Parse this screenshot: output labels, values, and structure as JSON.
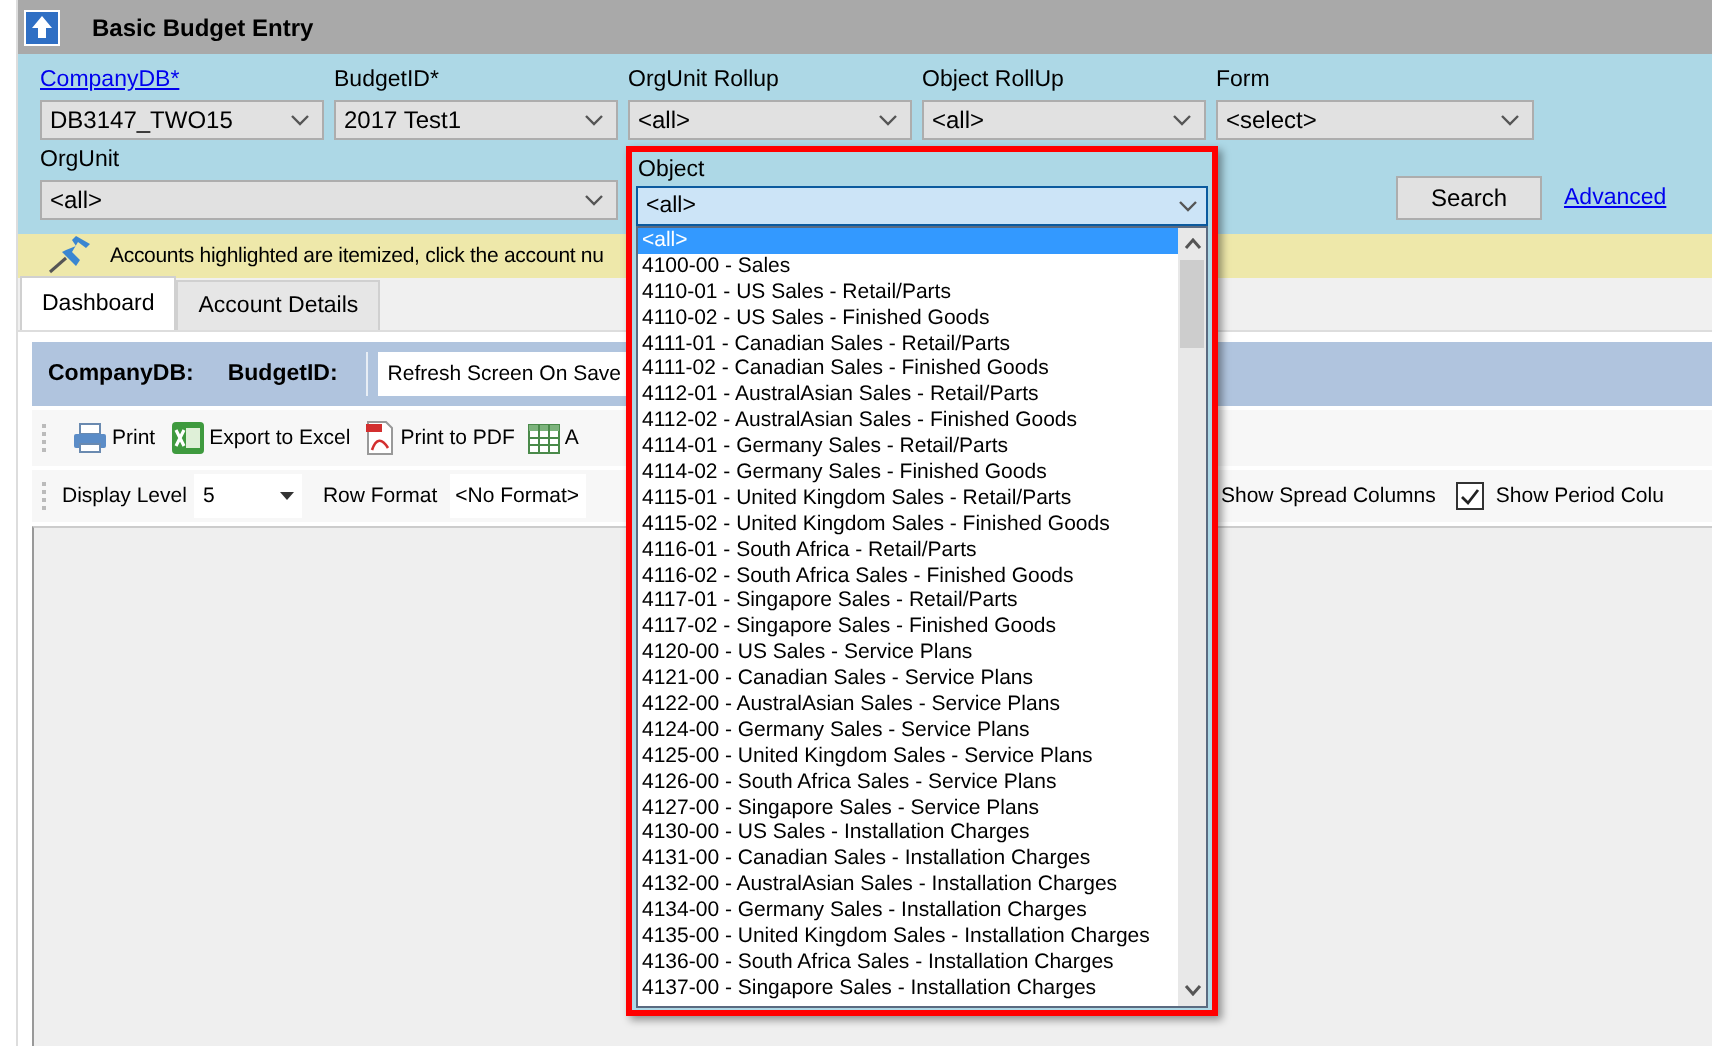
{
  "window": {
    "title": "Basic Budget Entry"
  },
  "filters": [
    {
      "label": "CompanyDB*",
      "kind": "link",
      "value": "DB3147_TWO15"
    },
    {
      "label": "BudgetID*",
      "kind": "plain",
      "value": "2017 Test1"
    },
    {
      "label": "OrgUnit Rollup",
      "kind": "plain",
      "value": "<all>"
    },
    {
      "label": "Object RollUp",
      "kind": "plain",
      "value": "<all>"
    },
    {
      "label": "Form",
      "kind": "plain",
      "value": "<select>"
    },
    {
      "label": "OrgUnit",
      "kind": "plain",
      "value": "<all>"
    }
  ],
  "search_button": "Search",
  "advanced_link": "Advanced",
  "notice": "Accounts highlighted are itemized, click the account nu",
  "tabs": [
    {
      "label": "Dashboard",
      "selected": true
    },
    {
      "label": "Account Details",
      "selected": false
    }
  ],
  "info_bar": {
    "company_label": "CompanyDB:",
    "budget_label": "BudgetID:",
    "refresh_value": "Refresh Screen On Save"
  },
  "toolbar": [
    {
      "label": "Print",
      "kind": "print"
    },
    {
      "label": "Export to Excel",
      "kind": "excel"
    },
    {
      "label": "Print to PDF",
      "kind": "pdf"
    },
    {
      "label": "A",
      "kind": "grid"
    }
  ],
  "options_bar": {
    "display_level_label": "Display Level",
    "display_level": "5",
    "row_format_label": "Row Format",
    "row_format": "<No Format>",
    "checkboxes": [
      {
        "label": "Show Spread Columns"
      },
      {
        "label": "Show Period Colu",
        "checked": true
      }
    ]
  },
  "object_dropdown": {
    "label": "Object",
    "value": "<all>",
    "options": [
      {
        "text": "<all>",
        "selected": true
      },
      {
        "text": "4100-00 - Sales",
        "selected": false
      },
      {
        "text": "4110-01 - US Sales - Retail/Parts",
        "selected": false
      },
      {
        "text": "4110-02 - US Sales - Finished Goods",
        "selected": false
      },
      {
        "text": "4111-01 - Canadian Sales - Retail/Parts",
        "selected": false
      },
      {
        "text": "4111-02 - Canadian Sales - Finished Goods",
        "selected": false
      },
      {
        "text": "4112-01 - AustralAsian Sales - Retail/Parts",
        "selected": false
      },
      {
        "text": "4112-02 - AustralAsian Sales - Finished Goods",
        "selected": false
      },
      {
        "text": "4114-01 - Germany Sales - Retail/Parts",
        "selected": false
      },
      {
        "text": "4114-02 - Germany Sales - Finished Goods",
        "selected": false
      },
      {
        "text": "4115-01 - United Kingdom Sales - Retail/Parts",
        "selected": false
      },
      {
        "text": "4115-02 - United Kingdom Sales - Finished Goods",
        "selected": false
      },
      {
        "text": "4116-01 - South Africa - Retail/Parts",
        "selected": false
      },
      {
        "text": "4116-02 - South Africa Sales - Finished Goods",
        "selected": false
      },
      {
        "text": "4117-01 - Singapore Sales - Retail/Parts",
        "selected": false
      },
      {
        "text": "4117-02 - Singapore Sales - Finished Goods",
        "selected": false
      },
      {
        "text": "4120-00 - US Sales - Service Plans",
        "selected": false
      },
      {
        "text": "4121-00 - Canadian Sales - Service Plans",
        "selected": false
      },
      {
        "text": "4122-00 - AustralAsian Sales - Service Plans",
        "selected": false
      },
      {
        "text": "4124-00 - Germany Sales - Service Plans",
        "selected": false
      },
      {
        "text": "4125-00 - United Kingdom Sales - Service Plans",
        "selected": false
      },
      {
        "text": "4126-00 - South Africa Sales - Service Plans",
        "selected": false
      },
      {
        "text": "4127-00 - Singapore Sales - Service Plans",
        "selected": false
      },
      {
        "text": "4130-00 - US Sales - Installation Charges",
        "selected": false
      },
      {
        "text": "4131-00 - Canadian Sales - Installation Charges",
        "selected": false
      },
      {
        "text": "4132-00 - AustralAsian Sales - Installation Charges",
        "selected": false
      },
      {
        "text": "4134-00 - Germany Sales - Installation Charges",
        "selected": false
      },
      {
        "text": "4135-00 - United Kingdom Sales - Installation Charges",
        "selected": false
      },
      {
        "text": "4136-00 - South Africa Sales - Installation Charges",
        "selected": false
      },
      {
        "text": "4137-00 - Singapore Sales - Installation Charges",
        "selected": false
      }
    ]
  }
}
